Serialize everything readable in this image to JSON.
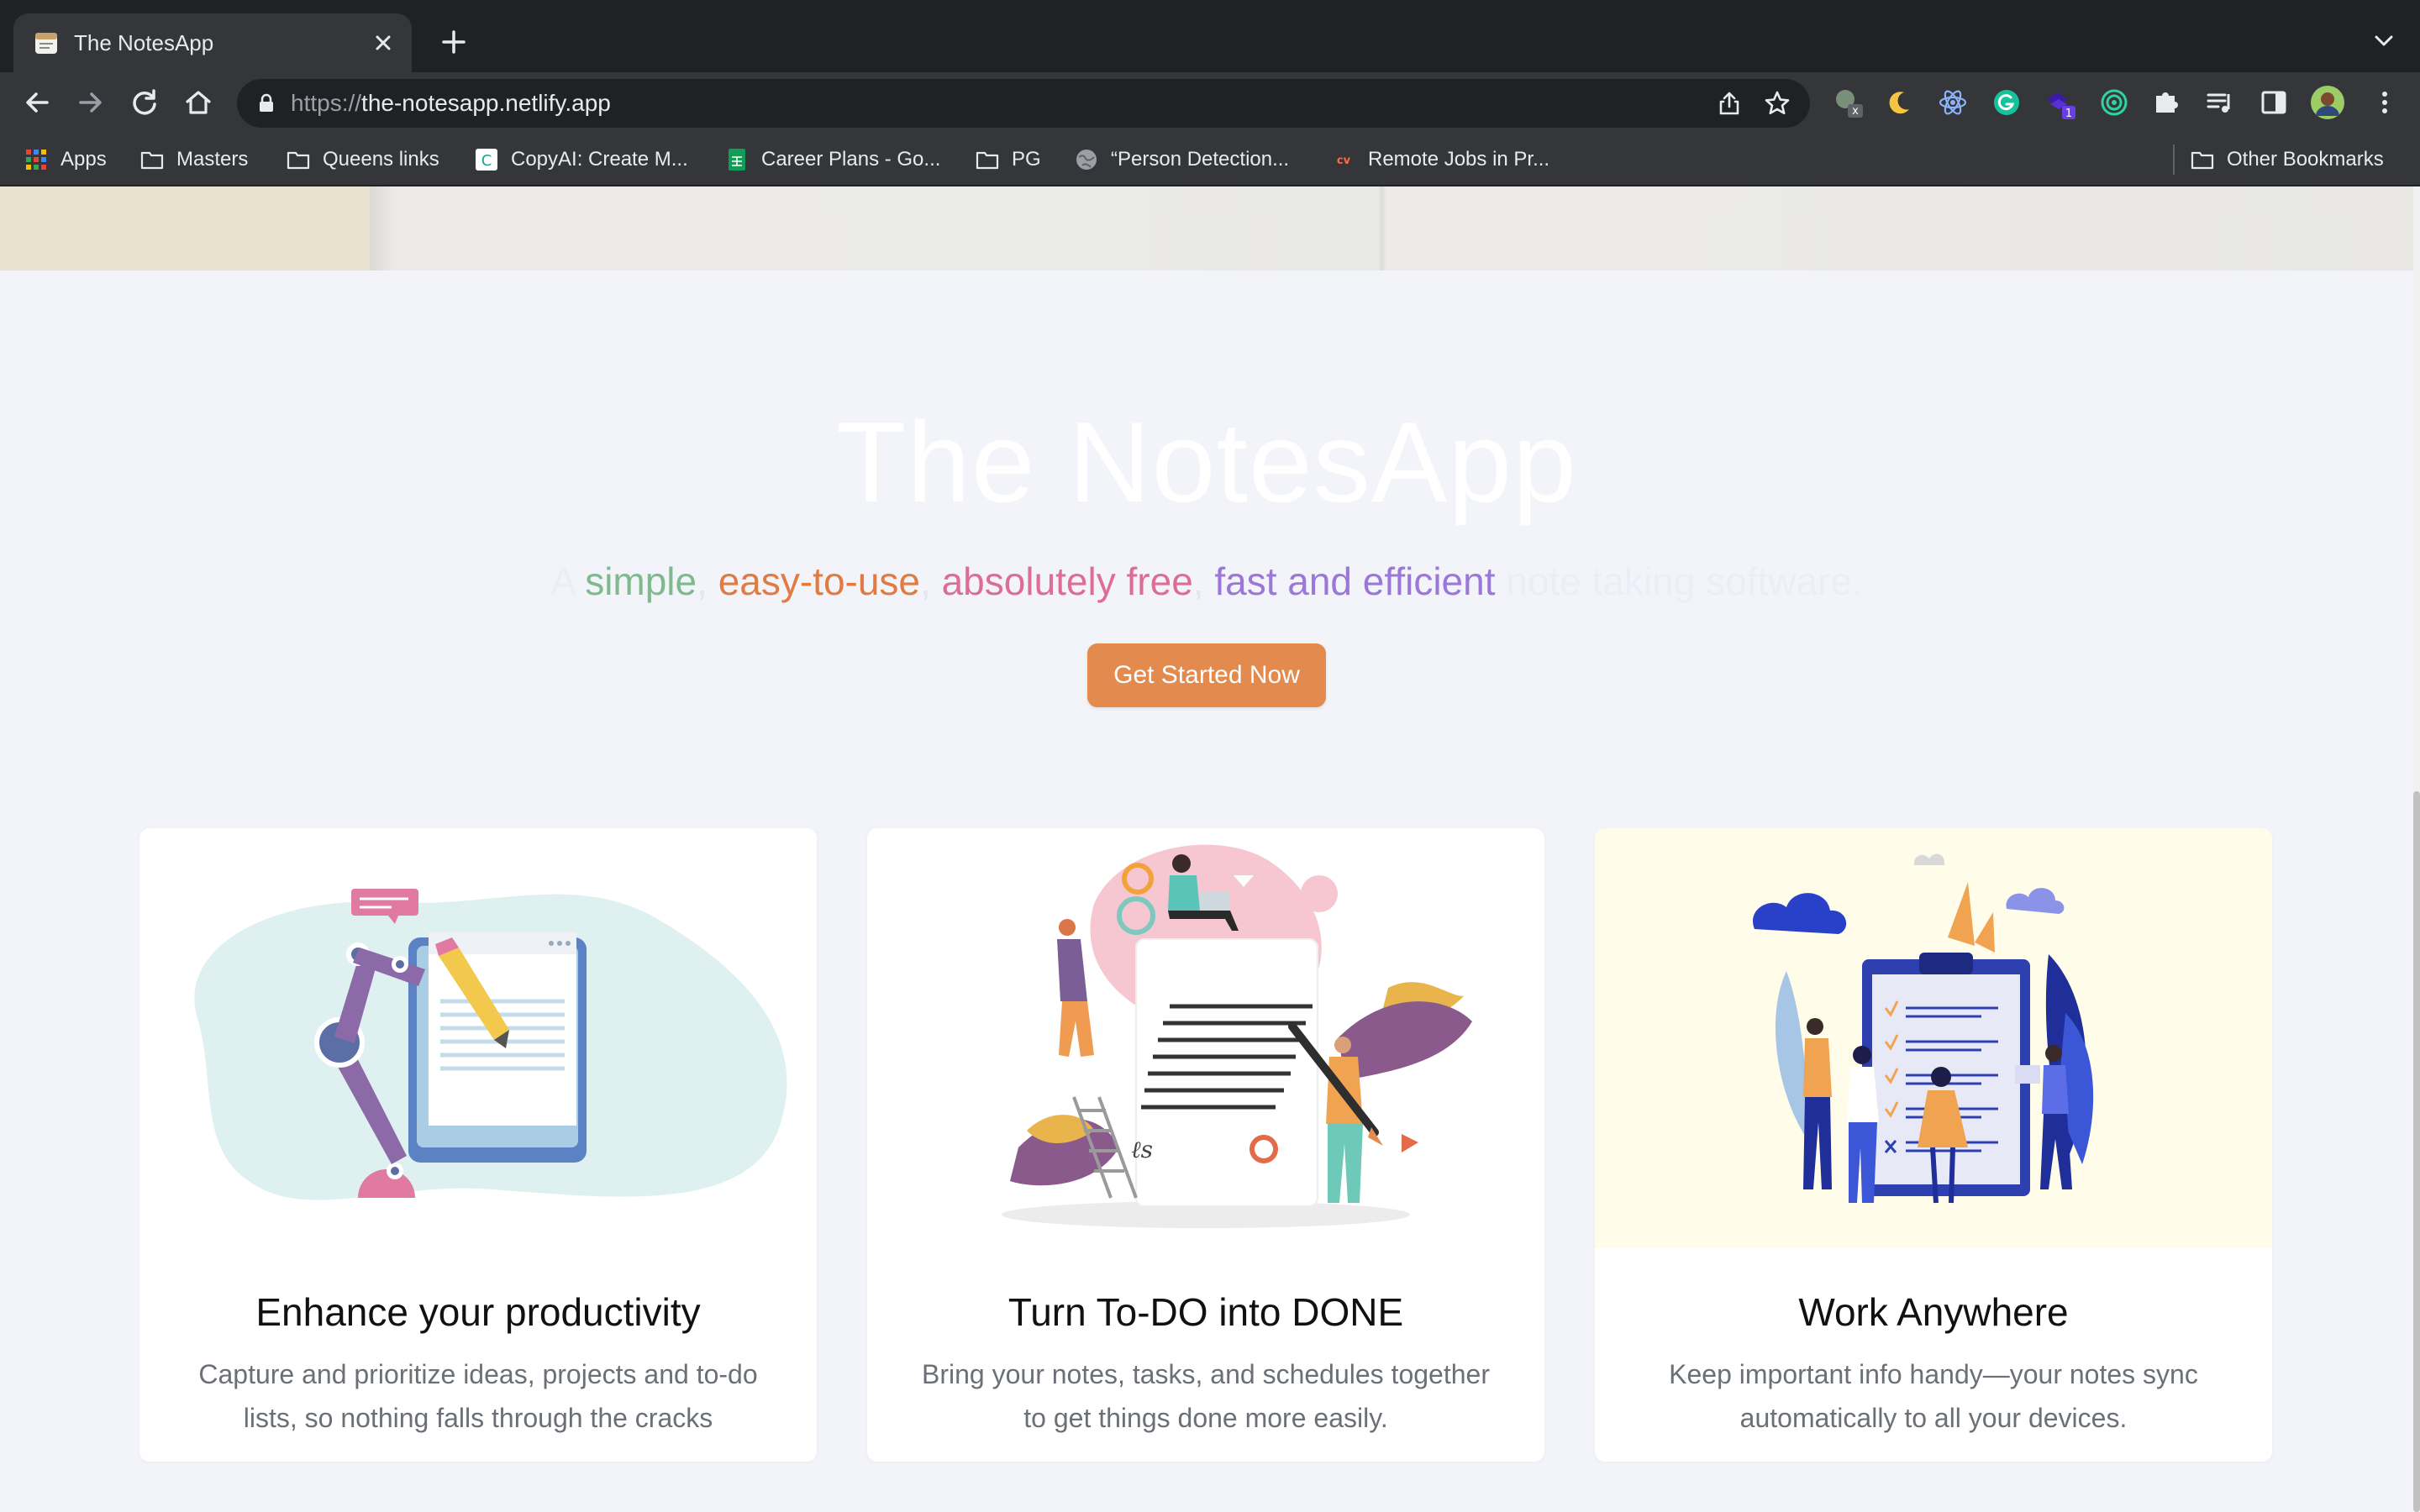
{
  "browser": {
    "tab": {
      "title": "The NotesApp",
      "favicon": "notes-favicon"
    },
    "url": {
      "scheme": "https://",
      "host": "the-notesapp.netlify.app"
    },
    "bookmarks": [
      {
        "label": "Apps",
        "icon": "apps-grid-icon"
      },
      {
        "label": "Masters",
        "icon": "folder-icon"
      },
      {
        "label": "Queens links",
        "icon": "folder-icon"
      },
      {
        "label": "CopyAI: Create M...",
        "icon": "copyai-icon"
      },
      {
        "label": "Career Plans - Go...",
        "icon": "sheets-icon"
      },
      {
        "label": "PG",
        "icon": "folder-icon"
      },
      {
        "label": "“Person Detection...",
        "icon": "globe-icon"
      },
      {
        "label": "Remote Jobs in Pr...",
        "icon": "cv-icon"
      }
    ],
    "other_bookmarks": "Other Bookmarks",
    "extensions": [
      "money-extension-icon",
      "moon-extension-icon",
      "react-devtools-icon",
      "grammarly-icon",
      "stacked-extension-icon",
      "target-extension-icon",
      "puzzle-extensions-icon",
      "media-queue-icon",
      "side-panel-icon",
      "profile-avatar",
      "more-menu-icon"
    ],
    "extension_badge": "1",
    "extension_x_badge": "x"
  },
  "hero": {
    "title": "The NotesApp",
    "tagline": {
      "prefix": "A ",
      "simple": "simple",
      "sep1": ", ",
      "easy": "easy-to-use",
      "sep2": ", ",
      "free": "absolutely free",
      "sep3": ", ",
      "fast": "fast and efficient",
      "suffix": " note taking software."
    },
    "cta": "Get Started Now"
  },
  "features": [
    {
      "title": "Enhance your productivity",
      "description": "Capture and prioritize ideas, projects and to-do lists, so nothing falls through the cracks",
      "illustration": "robot-arm-writing-illustration"
    },
    {
      "title": "Turn To-DO into DONE",
      "description": "Bring your notes, tasks, and schedules together to get things done more easily.",
      "illustration": "team-building-document-illustration"
    },
    {
      "title": "Work Anywhere",
      "description": "Keep important info handy—your notes sync automatically to all your devices.",
      "illustration": "team-checklist-illustration"
    }
  ],
  "colors": {
    "accent": "#e38a4e",
    "simple": "#7fb98e",
    "easy": "#e07b42",
    "free": "#de6d95",
    "fast": "#9a77d9",
    "page_bg": "#f3f4f9"
  }
}
